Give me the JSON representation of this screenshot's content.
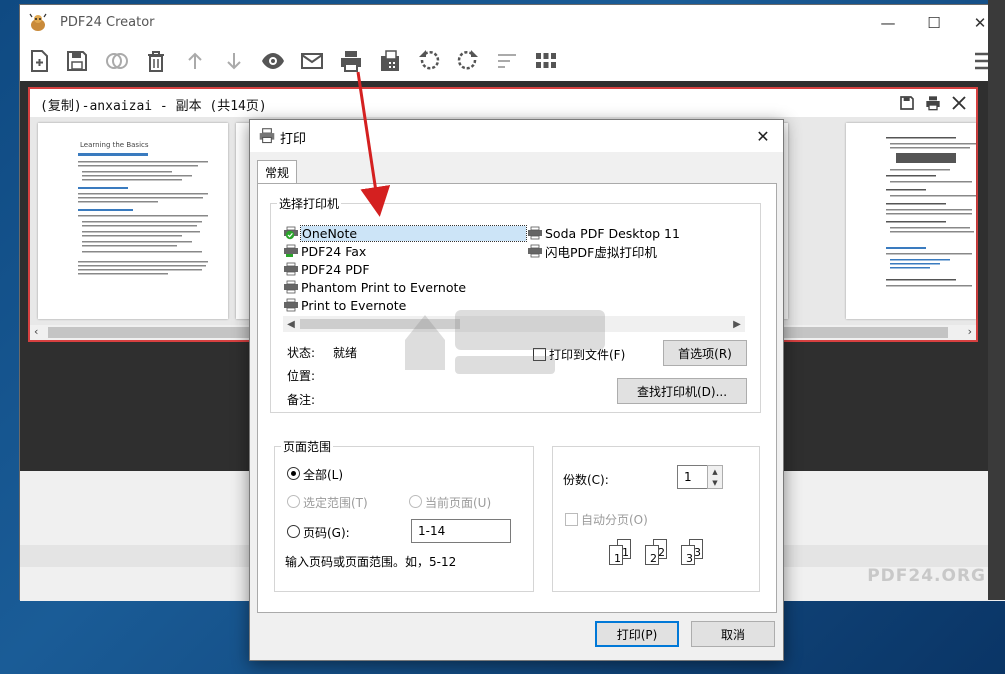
{
  "app": {
    "title": "PDF24 Creator",
    "brand": "PDF24.ORG",
    "window_controls": {
      "minimize": "—",
      "maximize": "☐",
      "close": "✕"
    }
  },
  "toolbar": {
    "buttons": [
      "new-file-icon",
      "save-icon",
      "merge-icon",
      "delete-icon",
      "move-up-icon",
      "move-down-icon",
      "preview-icon",
      "email-icon",
      "print-icon",
      "fax-icon",
      "rotate-left-icon",
      "rotate-right-icon",
      "sort-icon",
      "grid-icon",
      "menu-icon"
    ]
  },
  "document": {
    "title": "(复制)-anxaizai - 副本 (共14页)",
    "thumb_heading": "Learning the Basics"
  },
  "dialog": {
    "title": "打印",
    "tab_general": "常规",
    "select_printer_label": "选择打印机",
    "printers": [
      "OneNote",
      "PDF24 Fax",
      "PDF24 PDF",
      "Phantom Print to Evernote",
      "Print to Evernote",
      "Soda PDF Desktop 11",
      "闪电PDF虚拟打印机"
    ],
    "selected_printer": "OneNote",
    "status_label": "状态:",
    "status_value": "就绪",
    "location_label": "位置:",
    "comment_label": "备注:",
    "print_to_file_label": "打印到文件(F)",
    "preferences_button": "首选项(R)",
    "find_printer_button": "查找打印机(D)...",
    "page_range_label": "页面范围",
    "all_label": "全部(L)",
    "selection_label": "选定范围(T)",
    "current_page_label": "当前页面(U)",
    "pages_label": "页码(G):",
    "pages_value": "1-14",
    "pages_hint": "输入页码或页面范围。如，5-12",
    "copies_label": "份数(C):",
    "copies_value": "1",
    "collate_label": "自动分页(O)",
    "collate_numbers": [
      "1",
      "1",
      "2",
      "2",
      "3",
      "3"
    ],
    "print_button": "打印(P)",
    "cancel_button": "取消"
  },
  "colors": {
    "accent_border": "#d64040",
    "default_button_border": "#0078d7",
    "selection_highlight": "#cce4f7",
    "annotation_arrow": "#d42020"
  }
}
